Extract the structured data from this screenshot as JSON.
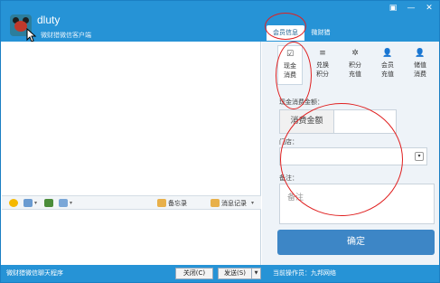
{
  "window": {
    "username": "dluty",
    "status_text": "微财猎微信客户端",
    "controls": [
      "▣",
      "—",
      "✕"
    ]
  },
  "tabs": [
    {
      "label": "会员信息",
      "active": true
    },
    {
      "label": "微财猎",
      "active": false
    }
  ],
  "toolbar": {
    "memo_label": "备忘录",
    "history_label": "消息记录"
  },
  "bottom": {
    "app_text": "微财猎微信聊天程序",
    "close_label": "关闭(C)",
    "send_label": "发送(S)",
    "operator_text": "当前操作员：九邦网络"
  },
  "functions": [
    {
      "icon": "check-square-icon",
      "glyph": "☑",
      "line1": "现金",
      "line2": "消费",
      "active": true
    },
    {
      "icon": "list-icon",
      "glyph": "≡",
      "line1": "兑换",
      "line2": "积分",
      "active": false
    },
    {
      "icon": "gear-icon",
      "glyph": "✲",
      "line1": "积分",
      "line2": "充值",
      "active": false
    },
    {
      "icon": "user-icon",
      "glyph": "👤",
      "line1": "会员",
      "line2": "充值",
      "active": false
    },
    {
      "icon": "user-icon",
      "glyph": "👤",
      "line1": "储值",
      "line2": "消费",
      "active": false
    }
  ],
  "form": {
    "cash_label": "现金消费金额：",
    "amount_addon": "消费金额",
    "amount_value": "",
    "store_label": "门店：",
    "store_value": "",
    "remark_label": "备注：",
    "remark_placeholder": "备注",
    "confirm_label": "确定"
  },
  "colors": {
    "titlebar": "#2693d6",
    "confirm": "#3d86c6",
    "annotation": "#e02020"
  }
}
